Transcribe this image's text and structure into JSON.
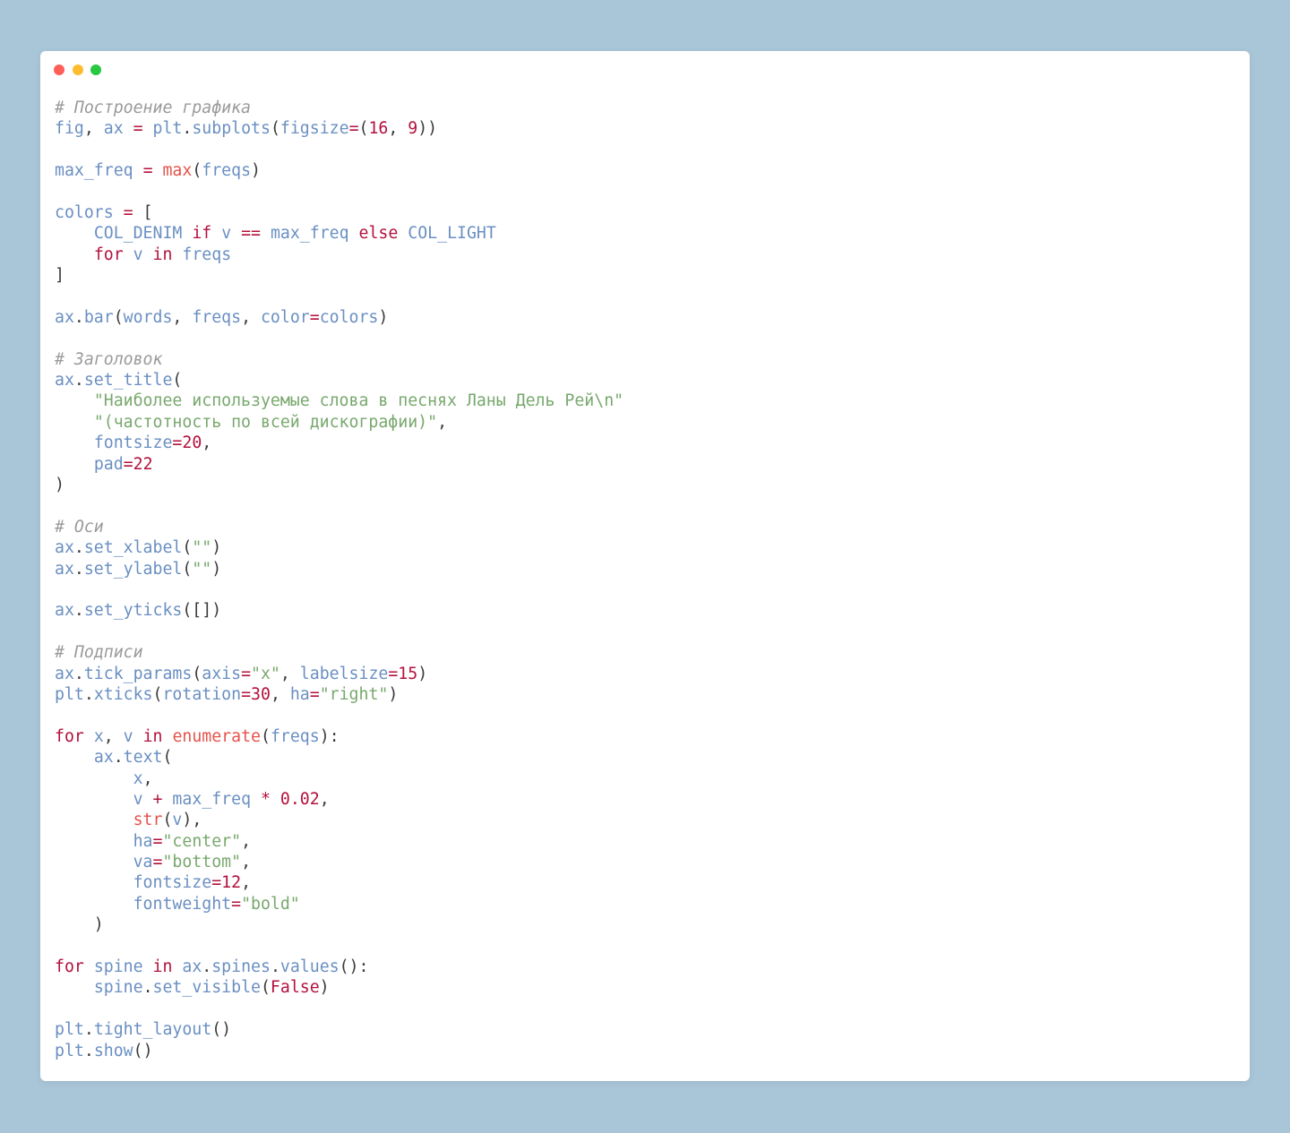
{
  "window": {
    "controls": [
      "close",
      "minimize",
      "maximize"
    ]
  },
  "colors": {
    "background": "#a9c6d8",
    "name": "#6a8fc2",
    "keyword": "#b3113d",
    "builtin": "#e5534b",
    "string": "#78a86d",
    "comment": "#9a9a9a"
  },
  "code_lines": [
    [
      [
        "c",
        "# Построение графика"
      ]
    ],
    [
      [
        "n",
        "fig"
      ],
      [
        "p",
        ", "
      ],
      [
        "n",
        "ax"
      ],
      [
        "p",
        " "
      ],
      [
        "k",
        "="
      ],
      [
        "p",
        " "
      ],
      [
        "n",
        "plt"
      ],
      [
        "p",
        "."
      ],
      [
        "n",
        "subplots"
      ],
      [
        "p",
        "("
      ],
      [
        "n",
        "figsize"
      ],
      [
        "k",
        "="
      ],
      [
        "p",
        "("
      ],
      [
        "k",
        "16"
      ],
      [
        "p",
        ", "
      ],
      [
        "k",
        "9"
      ],
      [
        "p",
        "))"
      ]
    ],
    [],
    [
      [
        "n",
        "max_freq"
      ],
      [
        "p",
        " "
      ],
      [
        "k",
        "="
      ],
      [
        "p",
        " "
      ],
      [
        "f",
        "max"
      ],
      [
        "p",
        "("
      ],
      [
        "n",
        "freqs"
      ],
      [
        "p",
        ")"
      ]
    ],
    [],
    [
      [
        "n",
        "colors"
      ],
      [
        "p",
        " "
      ],
      [
        "k",
        "="
      ],
      [
        "p",
        " ["
      ]
    ],
    [
      [
        "p",
        "    "
      ],
      [
        "n",
        "COL_DENIM"
      ],
      [
        "p",
        " "
      ],
      [
        "k",
        "if"
      ],
      [
        "p",
        " "
      ],
      [
        "n",
        "v"
      ],
      [
        "p",
        " "
      ],
      [
        "k",
        "=="
      ],
      [
        "p",
        " "
      ],
      [
        "n",
        "max_freq"
      ],
      [
        "p",
        " "
      ],
      [
        "k",
        "else"
      ],
      [
        "p",
        " "
      ],
      [
        "n",
        "COL_LIGHT"
      ]
    ],
    [
      [
        "p",
        "    "
      ],
      [
        "k",
        "for"
      ],
      [
        "p",
        " "
      ],
      [
        "n",
        "v"
      ],
      [
        "p",
        " "
      ],
      [
        "k",
        "in"
      ],
      [
        "p",
        " "
      ],
      [
        "n",
        "freqs"
      ]
    ],
    [
      [
        "p",
        "]"
      ]
    ],
    [],
    [
      [
        "n",
        "ax"
      ],
      [
        "p",
        "."
      ],
      [
        "n",
        "bar"
      ],
      [
        "p",
        "("
      ],
      [
        "n",
        "words"
      ],
      [
        "p",
        ", "
      ],
      [
        "n",
        "freqs"
      ],
      [
        "p",
        ", "
      ],
      [
        "n",
        "color"
      ],
      [
        "k",
        "="
      ],
      [
        "n",
        "colors"
      ],
      [
        "p",
        ")"
      ]
    ],
    [],
    [
      [
        "c",
        "# Заголовок"
      ]
    ],
    [
      [
        "n",
        "ax"
      ],
      [
        "p",
        "."
      ],
      [
        "n",
        "set_title"
      ],
      [
        "p",
        "("
      ]
    ],
    [
      [
        "p",
        "    "
      ],
      [
        "s",
        "\"Наиболее используемые слова в песнях Ланы Дель Рей\\n\""
      ]
    ],
    [
      [
        "p",
        "    "
      ],
      [
        "s",
        "\"(частотность по всей дискографии)\""
      ],
      [
        "p",
        ","
      ]
    ],
    [
      [
        "p",
        "    "
      ],
      [
        "n",
        "fontsize"
      ],
      [
        "k",
        "=20"
      ],
      [
        "p",
        ","
      ]
    ],
    [
      [
        "p",
        "    "
      ],
      [
        "n",
        "pad"
      ],
      [
        "k",
        "=22"
      ]
    ],
    [
      [
        "p",
        ")"
      ]
    ],
    [],
    [
      [
        "c",
        "# Оси"
      ]
    ],
    [
      [
        "n",
        "ax"
      ],
      [
        "p",
        "."
      ],
      [
        "n",
        "set_xlabel"
      ],
      [
        "p",
        "("
      ],
      [
        "s",
        "\"\""
      ],
      [
        "p",
        ")"
      ]
    ],
    [
      [
        "n",
        "ax"
      ],
      [
        "p",
        "."
      ],
      [
        "n",
        "set_ylabel"
      ],
      [
        "p",
        "("
      ],
      [
        "s",
        "\"\""
      ],
      [
        "p",
        ")"
      ]
    ],
    [],
    [
      [
        "n",
        "ax"
      ],
      [
        "p",
        "."
      ],
      [
        "n",
        "set_yticks"
      ],
      [
        "p",
        "([])"
      ]
    ],
    [],
    [
      [
        "c",
        "# Подписи"
      ]
    ],
    [
      [
        "n",
        "ax"
      ],
      [
        "p",
        "."
      ],
      [
        "n",
        "tick_params"
      ],
      [
        "p",
        "("
      ],
      [
        "n",
        "axis"
      ],
      [
        "k",
        "="
      ],
      [
        "s",
        "\"x\""
      ],
      [
        "p",
        ", "
      ],
      [
        "n",
        "labelsize"
      ],
      [
        "k",
        "=15"
      ],
      [
        "p",
        ")"
      ]
    ],
    [
      [
        "n",
        "plt"
      ],
      [
        "p",
        "."
      ],
      [
        "n",
        "xticks"
      ],
      [
        "p",
        "("
      ],
      [
        "n",
        "rotation"
      ],
      [
        "k",
        "=30"
      ],
      [
        "p",
        ", "
      ],
      [
        "n",
        "ha"
      ],
      [
        "k",
        "="
      ],
      [
        "s",
        "\"right\""
      ],
      [
        "p",
        ")"
      ]
    ],
    [],
    [
      [
        "k",
        "for"
      ],
      [
        "p",
        " "
      ],
      [
        "n",
        "x"
      ],
      [
        "p",
        ", "
      ],
      [
        "n",
        "v"
      ],
      [
        "p",
        " "
      ],
      [
        "k",
        "in"
      ],
      [
        "p",
        " "
      ],
      [
        "f",
        "enumerate"
      ],
      [
        "p",
        "("
      ],
      [
        "n",
        "freqs"
      ],
      [
        "p",
        "):"
      ]
    ],
    [
      [
        "p",
        "    "
      ],
      [
        "n",
        "ax"
      ],
      [
        "p",
        "."
      ],
      [
        "n",
        "text"
      ],
      [
        "p",
        "("
      ]
    ],
    [
      [
        "p",
        "        "
      ],
      [
        "n",
        "x"
      ],
      [
        "p",
        ","
      ]
    ],
    [
      [
        "p",
        "        "
      ],
      [
        "n",
        "v"
      ],
      [
        "p",
        " "
      ],
      [
        "k",
        "+"
      ],
      [
        "p",
        " "
      ],
      [
        "n",
        "max_freq"
      ],
      [
        "p",
        " "
      ],
      [
        "k",
        "*"
      ],
      [
        "p",
        " "
      ],
      [
        "k",
        "0.02"
      ],
      [
        "p",
        ","
      ]
    ],
    [
      [
        "p",
        "        "
      ],
      [
        "f",
        "str"
      ],
      [
        "p",
        "("
      ],
      [
        "n",
        "v"
      ],
      [
        "p",
        "),"
      ]
    ],
    [
      [
        "p",
        "        "
      ],
      [
        "n",
        "ha"
      ],
      [
        "k",
        "="
      ],
      [
        "s",
        "\"center\""
      ],
      [
        "p",
        ","
      ]
    ],
    [
      [
        "p",
        "        "
      ],
      [
        "n",
        "va"
      ],
      [
        "k",
        "="
      ],
      [
        "s",
        "\"bottom\""
      ],
      [
        "p",
        ","
      ]
    ],
    [
      [
        "p",
        "        "
      ],
      [
        "n",
        "fontsize"
      ],
      [
        "k",
        "=12"
      ],
      [
        "p",
        ","
      ]
    ],
    [
      [
        "p",
        "        "
      ],
      [
        "n",
        "fontweight"
      ],
      [
        "k",
        "="
      ],
      [
        "s",
        "\"bold\""
      ]
    ],
    [
      [
        "p",
        "    )"
      ]
    ],
    [],
    [
      [
        "k",
        "for"
      ],
      [
        "p",
        " "
      ],
      [
        "n",
        "spine"
      ],
      [
        "p",
        " "
      ],
      [
        "k",
        "in"
      ],
      [
        "p",
        " "
      ],
      [
        "n",
        "ax"
      ],
      [
        "p",
        "."
      ],
      [
        "n",
        "spines"
      ],
      [
        "p",
        "."
      ],
      [
        "n",
        "values"
      ],
      [
        "p",
        "():"
      ]
    ],
    [
      [
        "p",
        "    "
      ],
      [
        "n",
        "spine"
      ],
      [
        "p",
        "."
      ],
      [
        "n",
        "set_visible"
      ],
      [
        "p",
        "("
      ],
      [
        "k",
        "False"
      ],
      [
        "p",
        ")"
      ]
    ],
    [],
    [
      [
        "n",
        "plt"
      ],
      [
        "p",
        "."
      ],
      [
        "n",
        "tight_layout"
      ],
      [
        "p",
        "()"
      ]
    ],
    [
      [
        "n",
        "plt"
      ],
      [
        "p",
        "."
      ],
      [
        "n",
        "show"
      ],
      [
        "p",
        "()"
      ]
    ]
  ]
}
